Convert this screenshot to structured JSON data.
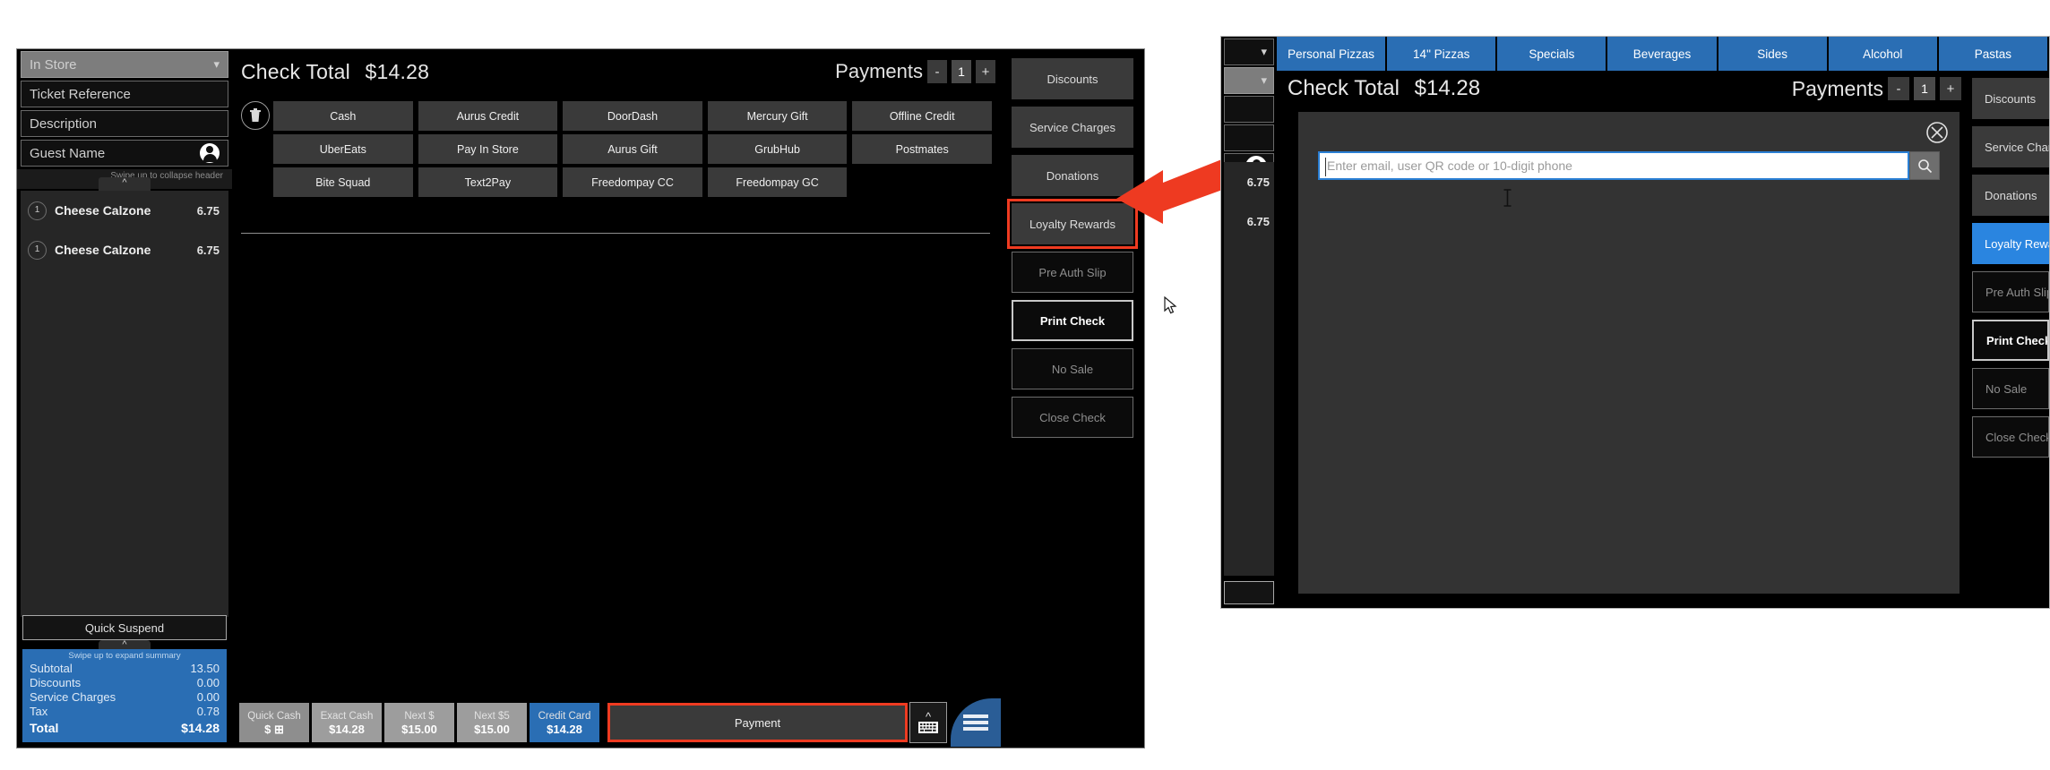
{
  "pos": {
    "ticket": {
      "order_type": "In Store",
      "order_type_icon": "chevron-down-icon",
      "ticket_reference_placeholder": "Ticket Reference",
      "description_placeholder": "Description",
      "guest_name_placeholder": "Guest Name",
      "guest_icon": "person-icon",
      "collapse_hint": "Swipe up to collapse header",
      "items": [
        {
          "qty": "1",
          "name": "Cheese Calzone",
          "price": "6.75"
        },
        {
          "qty": "1",
          "name": "Cheese Calzone",
          "price": "6.75"
        }
      ],
      "quick_suspend_label": "Quick Suspend",
      "summary_hint": "Swipe up to expand summary",
      "summary_rows": [
        {
          "label": "Subtotal",
          "value": "13.50"
        },
        {
          "label": "Discounts",
          "value": "0.00"
        },
        {
          "label": "Service Charges",
          "value": "0.00"
        },
        {
          "label": "Tax",
          "value": "0.78"
        }
      ],
      "total_label": "Total",
      "total_value": "$14.28"
    },
    "header": {
      "check_total_label": "Check Total",
      "check_total_amount": "$14.28",
      "payments_label": "Payments",
      "payments_minus": "-",
      "payments_count": "1",
      "payments_plus": "+"
    },
    "delete_icon": "trash-icon",
    "tenders": [
      "Cash",
      "Aurus Credit",
      "DoorDash",
      "Mercury Gift",
      "Offline Credit",
      "UberEats",
      "Pay In Store",
      "Aurus Gift",
      "GrubHub",
      "Postmates",
      "Bite Squad",
      "Text2Pay",
      "Freedompay CC",
      "Freedompay GC"
    ],
    "actions": [
      {
        "label": "Discounts",
        "style": "fill"
      },
      {
        "label": "Service Charges",
        "style": "fill"
      },
      {
        "label": "Donations",
        "style": "fill"
      },
      {
        "label": "Loyalty Rewards",
        "style": "fill"
      },
      {
        "label": "Pre Auth Slip",
        "style": "outline"
      },
      {
        "label": "Print Check",
        "style": "outline-strong"
      },
      {
        "label": "No Sale",
        "style": "outline"
      },
      {
        "label": "Close Check",
        "style": "outline"
      }
    ],
    "quick_tenders": [
      {
        "line1": "Quick Cash",
        "line2": "$ ⊞",
        "style": "dim"
      },
      {
        "line1": "Exact Cash",
        "line2": "$14.28",
        "style": "gray"
      },
      {
        "line1": "Next $",
        "line2": "$15.00",
        "style": "gray"
      },
      {
        "line1": "Next $5",
        "line2": "$15.00",
        "style": "gray"
      },
      {
        "line1": "Credit Card",
        "line2": "$14.28",
        "style": "blue"
      }
    ],
    "payment_button_label": "Payment",
    "keyboard_icon": "keyboard-up-icon",
    "menu_icon": "hamburger-menu-icon"
  },
  "callout": {
    "tabs": [
      "Personal Pizzas",
      "14\" Pizzas",
      "Specials",
      "Beverages",
      "Sides",
      "Alcohol",
      "Pastas"
    ],
    "header": {
      "check_total_label": "Check Total",
      "check_total_amount": "$14.28",
      "payments_label": "Payments",
      "payments_minus": "-",
      "payments_count": "1",
      "payments_plus": "+"
    },
    "close_icon": "close-circle-icon",
    "search_placeholder": "Enter email, user QR code or 10-digit phone",
    "search_icon": "search-icon",
    "items": [
      {
        "price": "6.75"
      },
      {
        "price": "6.75"
      }
    ],
    "actions": [
      {
        "label": "Discounts",
        "style": "fill"
      },
      {
        "label": "Service Charges",
        "style": "fill"
      },
      {
        "label": "Donations",
        "style": "fill"
      },
      {
        "label": "Loyalty Rewards",
        "style": "selected"
      },
      {
        "label": "Pre Auth Slip",
        "style": "outline"
      },
      {
        "label": "Print Check",
        "style": "outline-strong"
      },
      {
        "label": "No Sale",
        "style": "outline"
      },
      {
        "label": "Close Check",
        "style": "outline"
      }
    ]
  },
  "annotation": {
    "arrow_icon": "red-arrow-callout",
    "highlight_color": "#ef3b21",
    "accent_color": "#2a6eb4",
    "selected_color": "#2a85e0"
  }
}
